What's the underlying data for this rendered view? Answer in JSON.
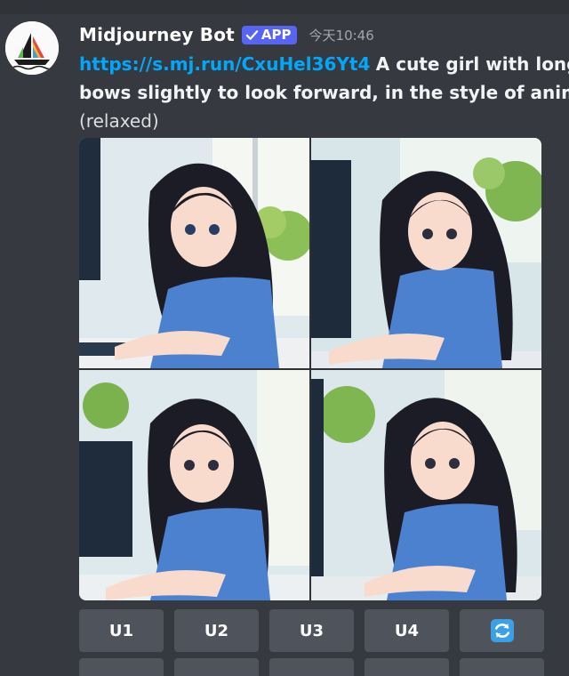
{
  "message": {
    "author": "Midjourney Bot",
    "badge": "APP",
    "timestamp": "今天10:46",
    "link": "https://s.mj.run/CxuHel36Yt4",
    "prompt_line1": "A cute girl with long b",
    "prompt_line2": "bows slightly to look forward, in the style of anime. T",
    "mode": "(relaxed)"
  },
  "image_grid": {
    "tiles": [
      "image-1",
      "image-2",
      "image-3",
      "image-4"
    ]
  },
  "buttons": [
    "U1",
    "U2",
    "U3",
    "U4"
  ],
  "reroll_icon": "refresh-icon",
  "colors": {
    "background": "#36393f",
    "link": "#00a8fc",
    "badge": "#5865f2",
    "button": "#4f545c",
    "reroll": "#3ba0e6"
  }
}
